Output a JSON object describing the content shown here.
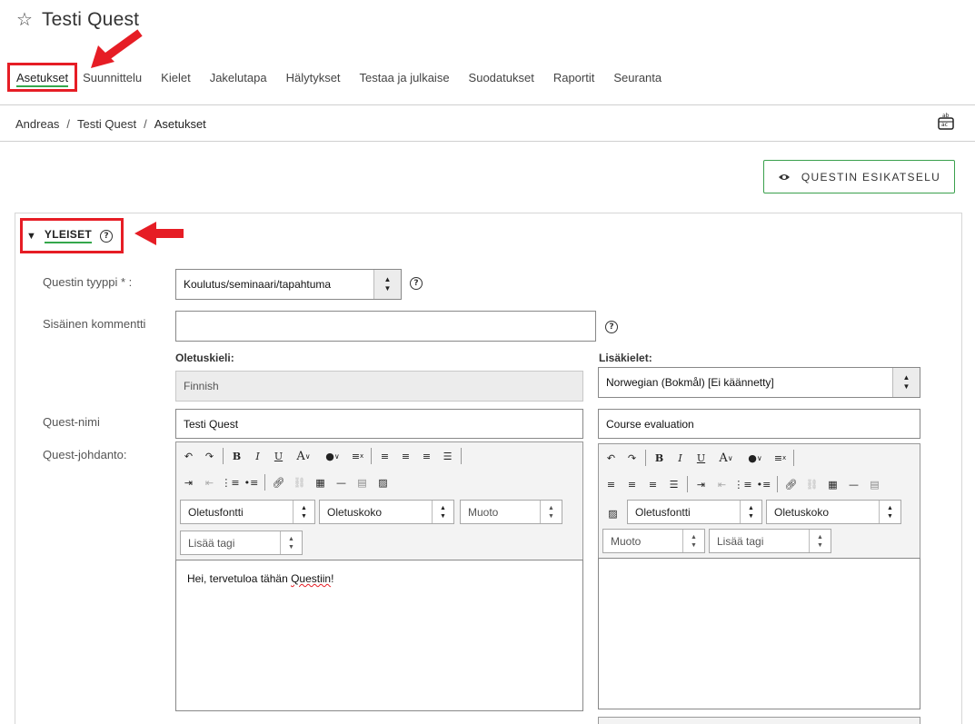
{
  "header": {
    "title": "Testi Quest",
    "star_icon": "star-outline-icon"
  },
  "tabs": [
    {
      "label": "Asetukset",
      "active": true
    },
    {
      "label": "Suunnittelu"
    },
    {
      "label": "Kielet"
    },
    {
      "label": "Jakelutapa"
    },
    {
      "label": "Hälytykset"
    },
    {
      "label": "Testaa ja julkaise"
    },
    {
      "label": "Suodatukset"
    },
    {
      "label": "Raportit"
    },
    {
      "label": "Seuranta"
    }
  ],
  "breadcrumb": [
    "Andreas",
    "Testi Quest",
    "Asetukset"
  ],
  "preview_button": "QUESTIN ESIKATSELU",
  "section": {
    "title": "YLEISET"
  },
  "form": {
    "type_label": "Questin tyyppi * :",
    "type_value": "Koulutus/seminaari/tapahtuma",
    "comment_label": "Sisäinen kommentti",
    "comment_value": "",
    "default_lang_label": "Oletuskieli:",
    "default_lang_value": "Finnish",
    "extra_lang_label": "Lisäkielet:",
    "extra_lang_value": "Norwegian (Bokmål) [Ei käännetty]",
    "name_label": "Quest-nimi",
    "name_default": "Testi Quest",
    "name_extra": "Course evaluation",
    "intro_label": "Quest-johdanto:"
  },
  "editor": {
    "font": "Oletusfontti",
    "size": "Oletuskoko",
    "format": "Muoto",
    "tag": "Lisää tagi",
    "body_prefix": "Hei, tervetuloa tähän ",
    "body_link": "Questiin",
    "body_suffix": "!"
  },
  "colors": {
    "accent_green": "#35a74b",
    "highlight_red": "#e61d25"
  }
}
